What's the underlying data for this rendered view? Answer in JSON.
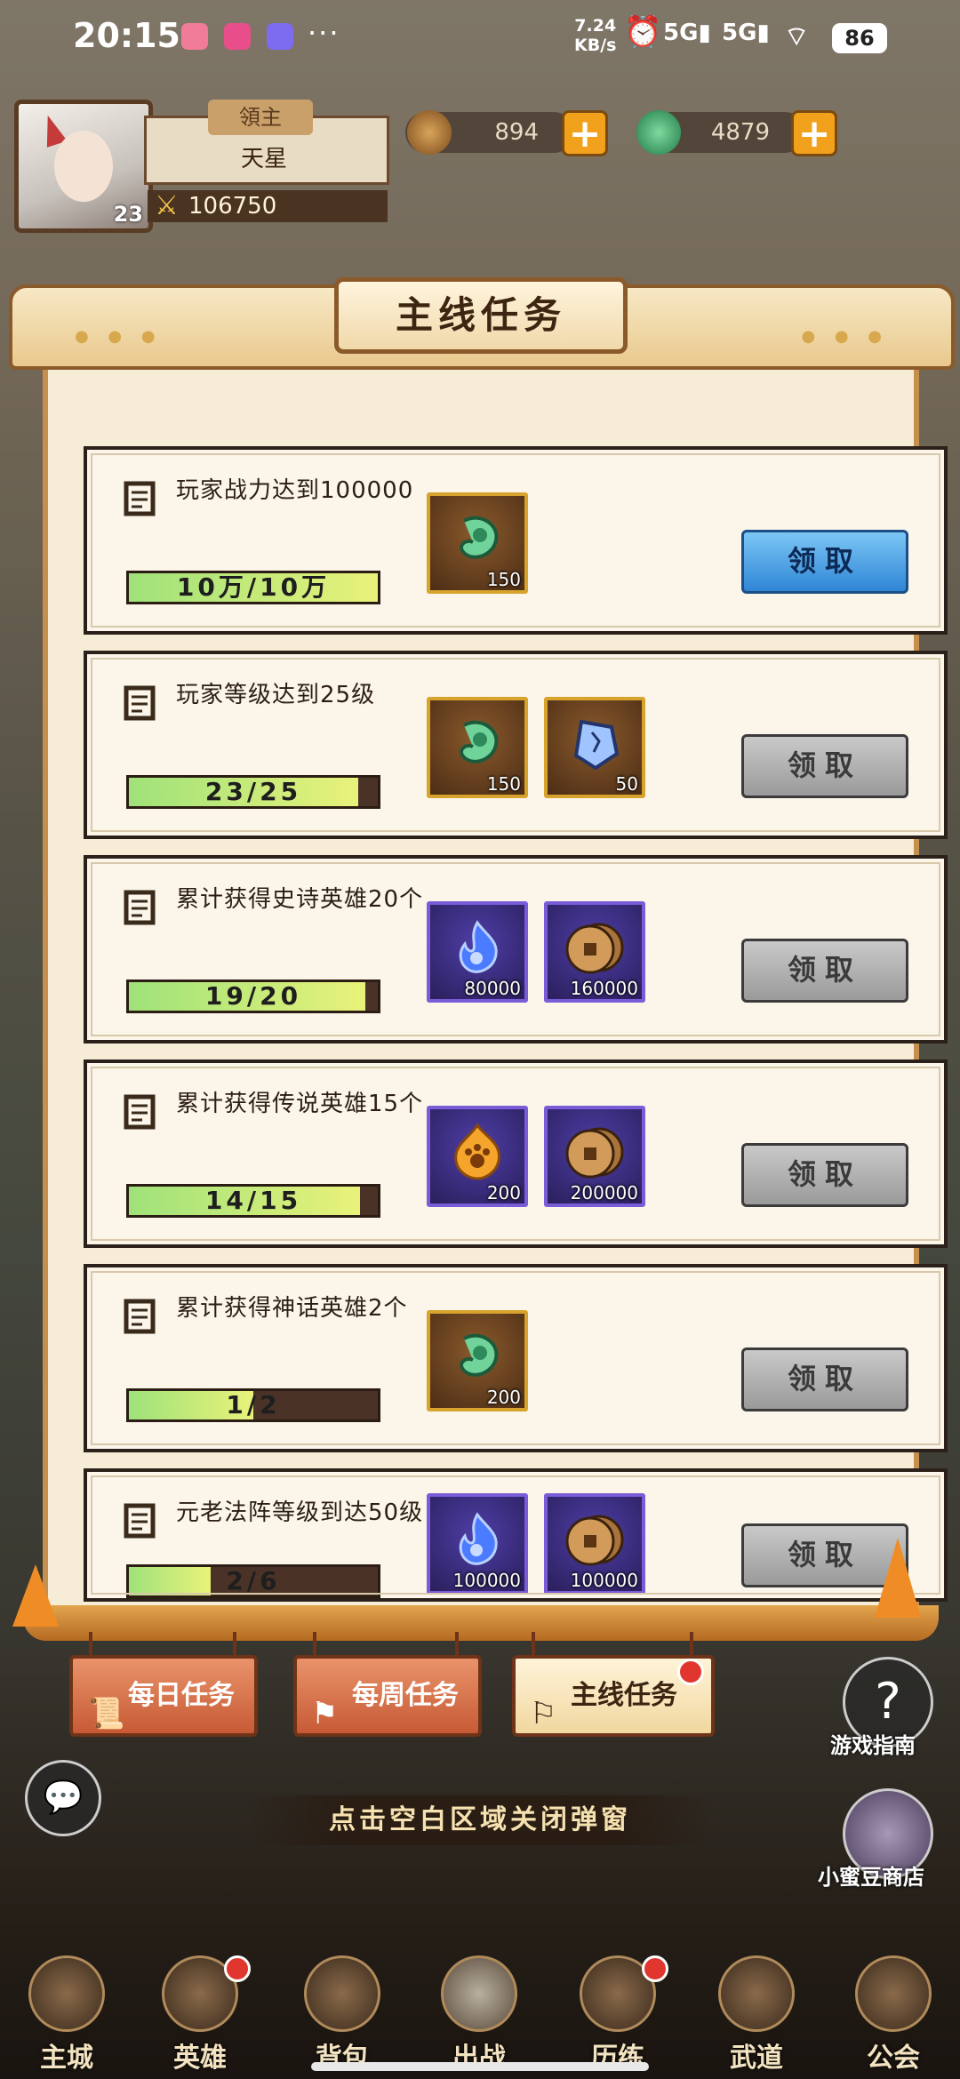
{
  "status_bar": {
    "time": "20:15",
    "net_speed_value": "7.24",
    "net_speed_unit": "KB/s",
    "signal1": "5G",
    "signal2": "5G",
    "battery": "86"
  },
  "hud": {
    "avatar_level": "23",
    "name_banner": "領主",
    "player_name": "天星",
    "power": "106750",
    "coins": "894",
    "jade": "4879"
  },
  "modal": {
    "title": "主线任务",
    "tasks": [
      {
        "title": "玩家战力达到100000",
        "progress_text": "10万/10万",
        "progress": 1.0,
        "rewards": [
          {
            "icon": "green-jade-icon",
            "qty": "150",
            "style": "brown"
          }
        ],
        "button": "领取",
        "button_state": "active"
      },
      {
        "title": "玩家等级达到25级",
        "progress_text": "23/25",
        "progress": 0.92,
        "rewards": [
          {
            "icon": "green-jade-icon",
            "qty": "150",
            "style": "brown"
          },
          {
            "icon": "blue-crystal-icon",
            "qty": "50",
            "style": "brown"
          }
        ],
        "button": "领取",
        "button_state": "disabled"
      },
      {
        "title": "累计获得史诗英雄20个",
        "progress_text": "19/20",
        "progress": 0.95,
        "rewards": [
          {
            "icon": "blue-spirit-flame-icon",
            "qty": "80000",
            "style": "purple"
          },
          {
            "icon": "copper-coin-icon",
            "qty": "160000",
            "style": "purple"
          }
        ],
        "button": "领取",
        "button_state": "disabled"
      },
      {
        "title": "累计获得传说英雄15个",
        "progress_text": "14/15",
        "progress": 0.93,
        "rewards": [
          {
            "icon": "orange-paw-flame-icon",
            "qty": "200",
            "style": "purple"
          },
          {
            "icon": "copper-coin-icon",
            "qty": "200000",
            "style": "purple"
          }
        ],
        "button": "领取",
        "button_state": "disabled"
      },
      {
        "title": "累计获得神话英雄2个",
        "progress_text": "1/2",
        "progress": 0.5,
        "rewards": [
          {
            "icon": "green-jade-icon",
            "qty": "200",
            "style": "brown"
          }
        ],
        "button": "领取",
        "button_state": "disabled"
      },
      {
        "title": "元老法阵等级到达50级",
        "progress_text": "2/6",
        "progress": 0.33,
        "rewards": [
          {
            "icon": "blue-spirit-flame-icon",
            "qty": "100000",
            "style": "purple"
          },
          {
            "icon": "copper-coin-icon",
            "qty": "100000",
            "style": "purple"
          }
        ],
        "button": "领取",
        "button_state": "disabled"
      }
    ]
  },
  "tabs": [
    {
      "label": "每日任务",
      "icon": "scroll-icon"
    },
    {
      "label": "每周任务",
      "icon": "flag-icon"
    },
    {
      "label": "主线任务",
      "icon": "banner-icon"
    }
  ],
  "close_hint": "点击空白区域关闭弹窗",
  "side": {
    "guide_label": "游戏指南",
    "shop_label": "小蜜豆商店"
  },
  "nav": [
    "主城",
    "英雄",
    "背包",
    "出战",
    "历练",
    "武道",
    "公会"
  ],
  "colors": {
    "accent_blue": "#2f86d6",
    "progress_green": "#9fe27a",
    "frame_brown": "#8a5a2a"
  }
}
